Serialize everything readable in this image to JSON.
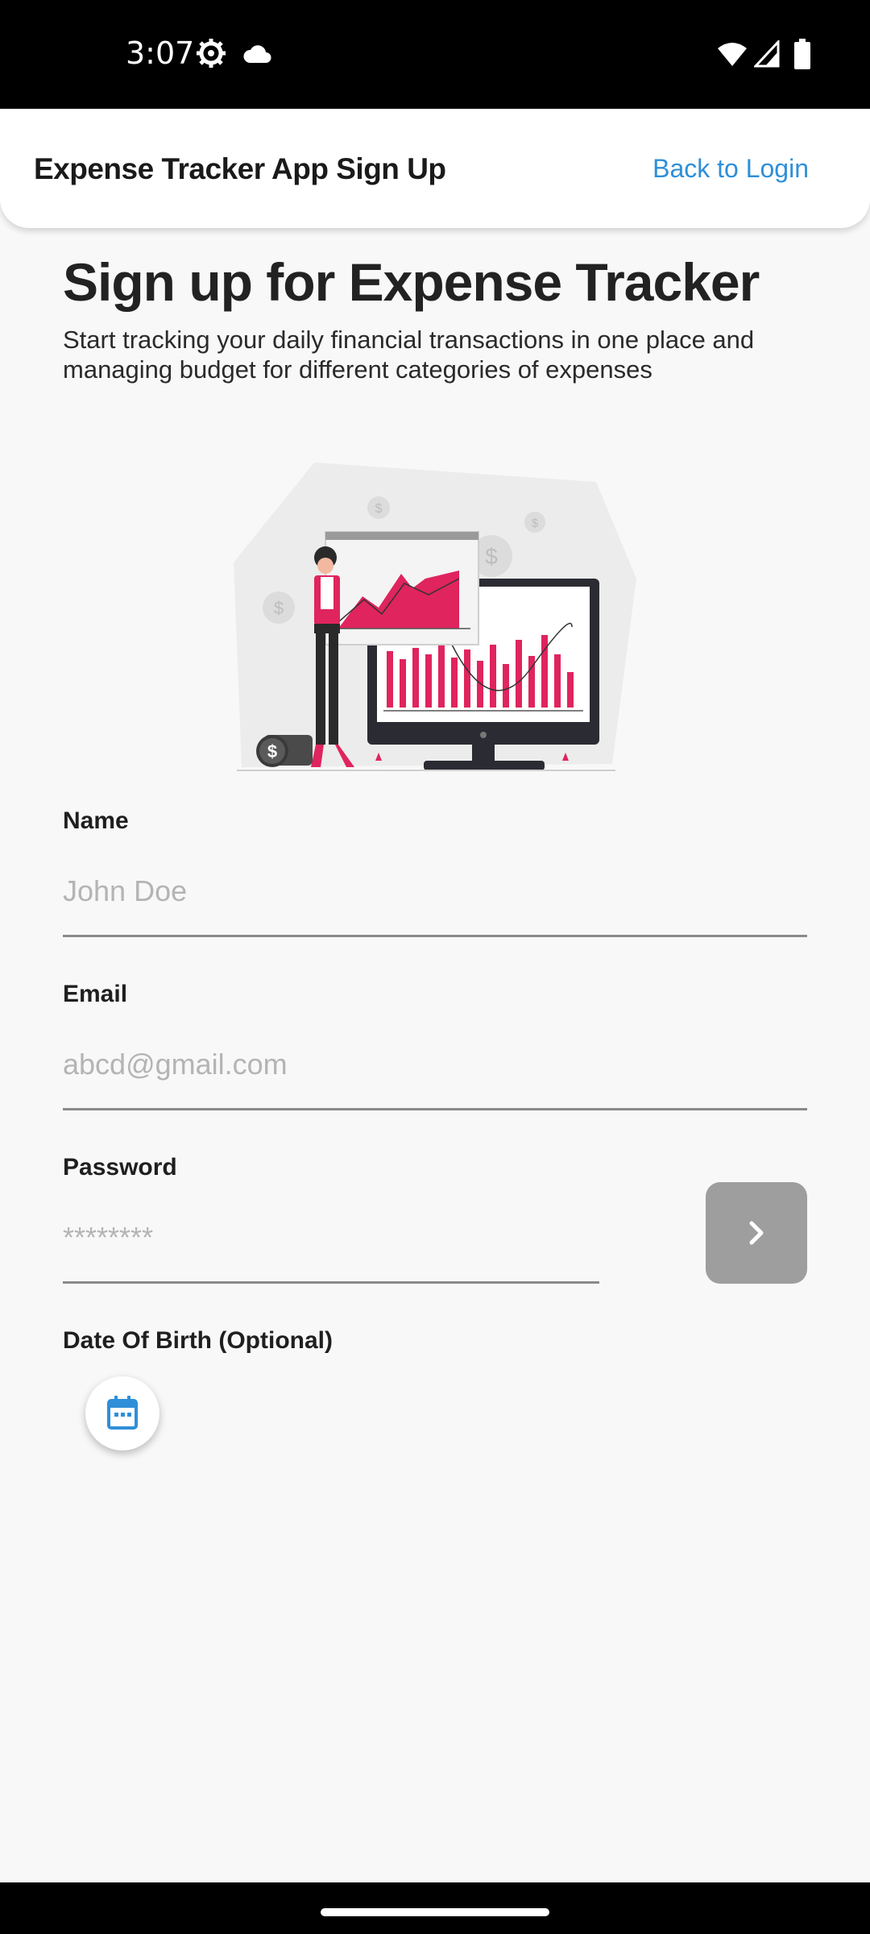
{
  "status_bar": {
    "time": "3:07",
    "icons": [
      "gear-icon",
      "cloud-icon",
      "wifi-icon",
      "signal-icon",
      "battery-icon"
    ]
  },
  "app_bar": {
    "title": "Expense Tracker App Sign Up",
    "back_link": "Back to Login"
  },
  "header": {
    "title": "Sign up for Expense Tracker",
    "subtitle": "Start tracking your daily financial transactions in one place and managing budget for different categories of expenses"
  },
  "form": {
    "name": {
      "label": "Name",
      "placeholder": "John Doe",
      "value": ""
    },
    "email": {
      "label": "Email",
      "placeholder": "abcd@gmail.com",
      "value": ""
    },
    "password": {
      "label": "Password",
      "placeholder": "********",
      "value": ""
    },
    "dob": {
      "label": "Date Of Birth (Optional)"
    },
    "next_icon": "chevron-right-icon",
    "calendar_icon": "calendar-icon"
  },
  "colors": {
    "accent": "#2f8fd8",
    "chart_pink": "#e0245e",
    "button_disabled": "#9e9e9e"
  }
}
